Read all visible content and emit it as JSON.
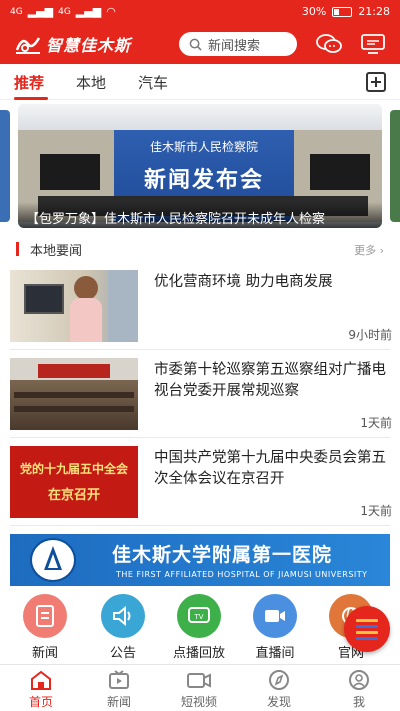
{
  "status_bar": {
    "signal_left": "4G",
    "signal_right": "4G",
    "battery": "30%",
    "time": "21:28"
  },
  "header": {
    "logo_text": "智慧佳木斯",
    "search_placeholder": "新闻搜索",
    "brand_color": "#e4261c"
  },
  "tabs": {
    "items": [
      {
        "label": "推荐",
        "active": true
      },
      {
        "label": "本地",
        "active": false
      },
      {
        "label": "汽车",
        "active": false
      }
    ],
    "add_icon": "plus-square-icon"
  },
  "banner": {
    "sign_line1": "佳木斯市人民检察院",
    "sign_line2": "新闻发布会",
    "caption": "【包罗万象】佳木斯市人民检察院召开未成年人检察"
  },
  "section": {
    "title": "本地要闻",
    "more": "更多 ›"
  },
  "news": [
    {
      "headline": "优化营商环境 助力电商发展",
      "time": "9小时前"
    },
    {
      "headline": "市委第十轮巡察第五巡察组对广播电视台党委开展常规巡察",
      "time": "1天前"
    },
    {
      "headline": "中国共产党第十九届中央委员会第五次全体会议在京召开",
      "time": "1天前",
      "thumb_text1": "党的十九届五中全会",
      "thumb_text2": "在京召开"
    }
  ],
  "ad": {
    "title": "佳木斯大学附属第一医院",
    "subtitle": "THE FIRST AFFILIATED HOSPITAL OF JIAMUSI UNIVERSITY"
  },
  "shortcuts": [
    {
      "label": "新闻",
      "icon": "document-icon",
      "color": "#f07c73"
    },
    {
      "label": "公告",
      "icon": "speaker-icon",
      "color": "#3aa6d6"
    },
    {
      "label": "点播回放",
      "icon": "tv-icon",
      "color": "#3db04a"
    },
    {
      "label": "直播间",
      "icon": "video-camera-icon",
      "color": "#4a8fe0"
    },
    {
      "label": "官网",
      "icon": "globe-icon",
      "color": "#e0763a"
    }
  ],
  "bottom_nav": [
    {
      "label": "首页",
      "icon": "home-icon",
      "active": true
    },
    {
      "label": "新闻",
      "icon": "news-tv-icon",
      "active": false
    },
    {
      "label": "短视频",
      "icon": "short-video-icon",
      "active": false
    },
    {
      "label": "发现",
      "icon": "compass-icon",
      "active": false
    },
    {
      "label": "我",
      "icon": "user-icon",
      "active": false
    }
  ]
}
